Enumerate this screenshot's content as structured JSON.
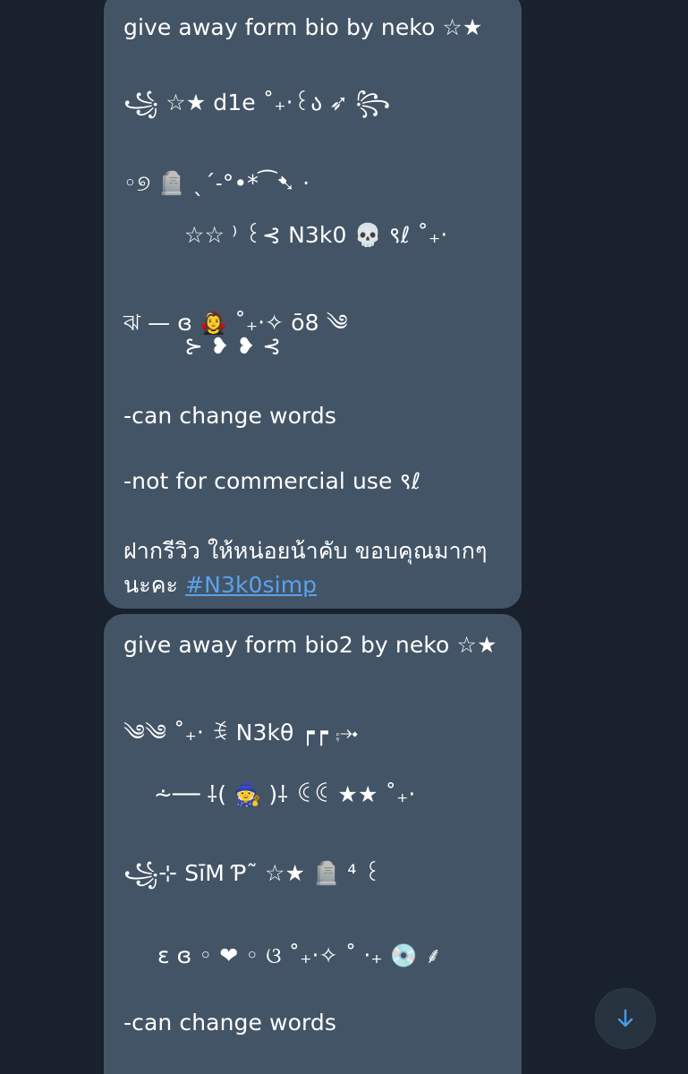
{
  "messages": [
    {
      "title": "give away form bio by neko ☆★",
      "line1": "꧁ ☆★ d1e ˚₊‧꒰ა ➶ ꧂",
      "line2": "◦୭ 🪦 ˎˊ˗°•*⁀➷ ·",
      "line3": "☆☆ ⁾ ꒰⊰ N3k0 💀 ९ℓ ˚₊‧",
      "line4": "ঝ — ɞ 🧛‍♀️ ˚₊‧✧ ō8 ༄",
      "line5": "⊱ ❥ ❥ ⊰",
      "note1": "-can change words",
      "note2": "-not for commercial use ९ℓ",
      "thai1": "ฝากรีวิว ให้หน่อยน้าคับ ขอบคุณมากๆ",
      "thai2": "นะคะ",
      "hashtag": "#N3k0simp"
    },
    {
      "title": "give away form bio2 by neko ☆★",
      "line1": "༄༄ ˚₊‧ ꉂ N3kθ ┍┍ ⨾⤞",
      "line2": "⩪── ⸸( 🧙 )⸸ ꀯꀯ ★★ ˚₊‧",
      "line3": "꧁⊹ SīM Ƥ˜ ☆★ 🪦 ⁴ ꒰",
      "line4": "ɛ ɞ ◦ ❤ ◦ ଓ ˚₊‧✧ ˚ ‧₊ 💿 ⸙",
      "note1": "-can change words"
    }
  ],
  "scroll_button": {
    "icon": "arrow-down-icon"
  },
  "colors": {
    "background": "#18212c",
    "bubble": "#435466",
    "text": "#ffffff",
    "link": "#5aa2ea",
    "accent": "#4a9ae6"
  }
}
